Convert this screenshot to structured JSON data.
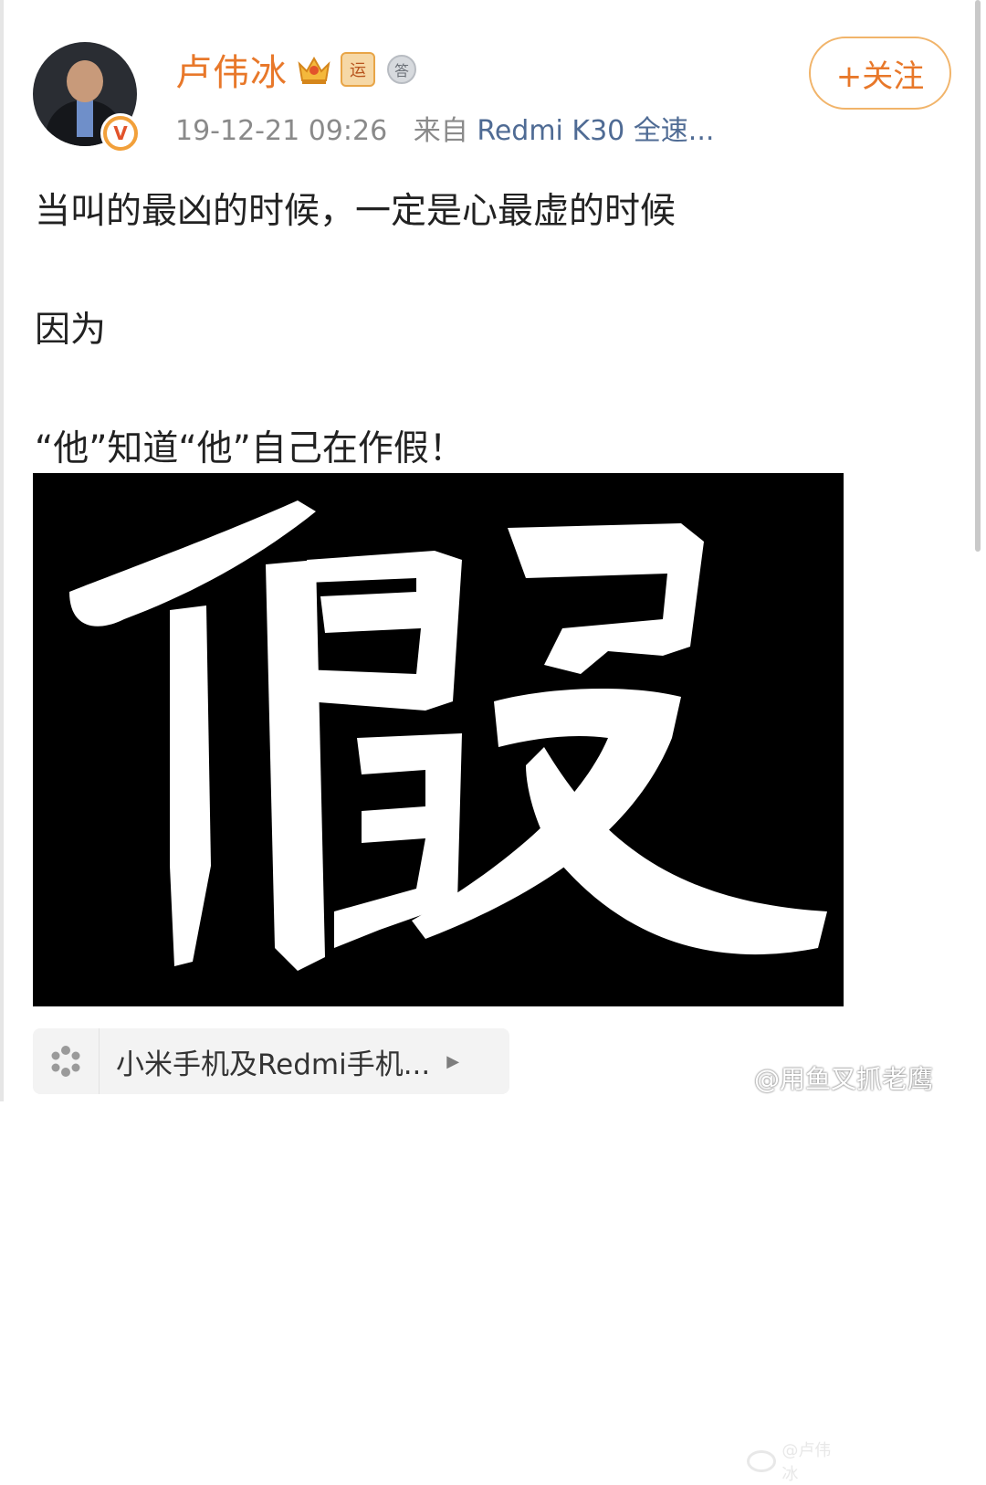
{
  "author": {
    "name": "卢伟冰",
    "badges": [
      "crown-icon",
      "运",
      "答"
    ],
    "verified_badge": "V",
    "timestamp": "19-12-21 09:26",
    "source_prefix": "来自",
    "source": "Redmi K30 全速..."
  },
  "follow_button": {
    "label": "+关注"
  },
  "post": {
    "lines": [
      "当叫的最凶的时候，一定是心最虚的时候",
      "因为",
      "“他”知道“他”自己在作假！"
    ],
    "image": {
      "character": "假",
      "watermark": "@卢伟冰"
    }
  },
  "topic": {
    "label": "小米手机及Redmi手机...",
    "icon": "pinwheel-icon",
    "arrow": "▶"
  },
  "footer_watermark": "@用鱼叉抓老鹰",
  "colors": {
    "accent": "#e8782a",
    "link": "#4f6b94",
    "meta": "#8a8a8a"
  }
}
